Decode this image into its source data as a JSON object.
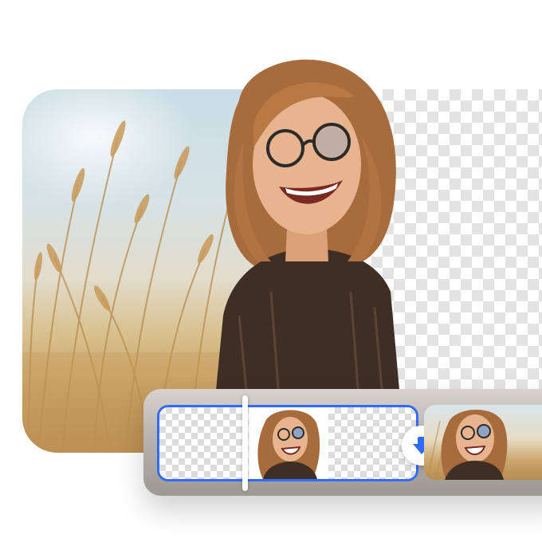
{
  "scene": {
    "description_kind": "background-removal-preview",
    "panels": {
      "left": "original-photo",
      "right": "transparent-background"
    }
  },
  "controls": {
    "compare_handle": "compare-slider-handle",
    "download_icon": "download-arrow-icon"
  },
  "colors": {
    "accent": "#2f6bff",
    "checker_light": "#ffffff",
    "checker_dark": "#e3e3e3",
    "bar_top": "#d7d2cc",
    "bar_bottom": "#9e9892"
  }
}
